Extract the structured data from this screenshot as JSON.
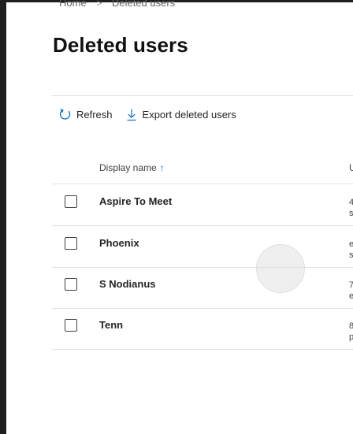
{
  "breadcrumb": {
    "home": "Home",
    "separator": ">",
    "current": "Deleted users"
  },
  "page": {
    "title": "Deleted users"
  },
  "toolbar": {
    "refresh_label": "Refresh",
    "refresh_icon": "refresh-icon",
    "export_label": "Export deleted users",
    "export_icon": "download-icon"
  },
  "table": {
    "columns": {
      "display_name": "Display name",
      "sort_indicator": "↑",
      "username": "U"
    },
    "rows": [
      {
        "name": "Aspire To Meet",
        "upn_line1": "4",
        "upn_line2": "s"
      },
      {
        "name": "Phoenix",
        "upn_line1": "e",
        "upn_line2": "s"
      },
      {
        "name": "S Nodianus",
        "upn_line1": "7",
        "upn_line2": "e"
      },
      {
        "name": "Tenn",
        "upn_line1": "8",
        "upn_line2": "p"
      }
    ]
  },
  "colors": {
    "accent": "#0f6cbd",
    "text": "#242424",
    "divider": "#e1e1e1"
  }
}
